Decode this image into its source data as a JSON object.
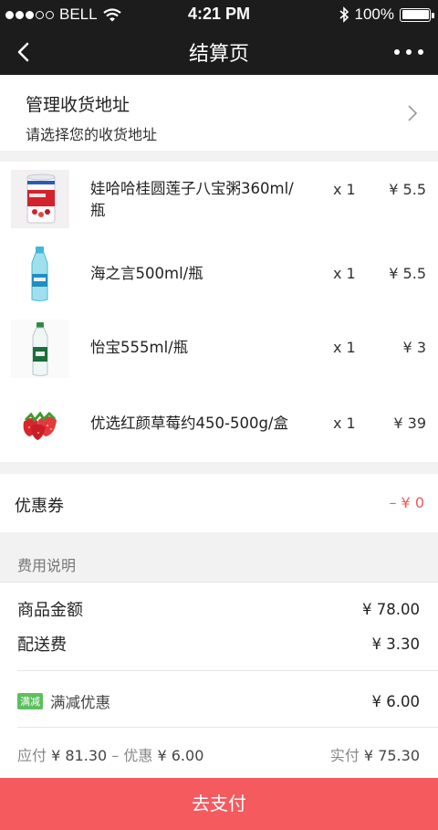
{
  "status_bar": {
    "carrier": "BELL",
    "time": "4:21 PM",
    "battery": "100%"
  },
  "nav": {
    "title": "结算页"
  },
  "address": {
    "title": "管理收货地址",
    "subtitle": "请选择您的收货地址"
  },
  "products": [
    {
      "name": "娃哈哈桂圆莲子八宝粥360ml/瓶",
      "qty": "x 1",
      "price": "¥ 5.5",
      "image": "porridge-can"
    },
    {
      "name": "海之言500ml/瓶",
      "qty": "x 1",
      "price": "¥ 5.5",
      "image": "blue-bottle"
    },
    {
      "name": "怡宝555ml/瓶",
      "qty": "x 1",
      "price": "¥ 3",
      "image": "water-bottle"
    },
    {
      "name": "优选红颜草莓约450-500g/盒",
      "qty": "x 1",
      "price": "¥ 39",
      "image": "strawberries"
    }
  ],
  "coupon": {
    "label": "优惠券",
    "value": "– ¥ 0"
  },
  "fees": {
    "header": "费用说明",
    "goods_label": "商品金额",
    "goods_value": "¥ 78.00",
    "delivery_label": "配送费",
    "delivery_value": "¥ 3.30",
    "promo_tag": "满减",
    "promo_label": "满减优惠",
    "promo_value": "¥ 6.00",
    "payable_label": "应付",
    "payable_value": "¥ 81.30",
    "dash": "–",
    "discount_label": "优惠",
    "discount_value": "¥ 6.00",
    "actual_label": "实付",
    "actual_value": "¥ 75.30"
  },
  "pay_button": "去支付",
  "colors": {
    "nav_bg": "#1c1c1c",
    "pay_bg": "#f55a5f",
    "coupon_red": "#ee5a5a",
    "promo_green": "#5cbf5c"
  }
}
